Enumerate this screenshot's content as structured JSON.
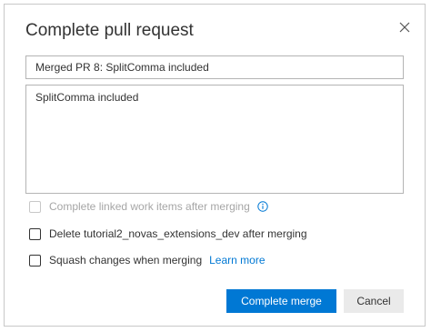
{
  "dialog": {
    "title": "Complete pull request",
    "close_icon": "close-icon"
  },
  "form": {
    "title_value": "Merged PR 8: SplitComma included",
    "description_value": "SplitComma included"
  },
  "options": {
    "complete_work_items": {
      "label": "Complete linked work items after merging",
      "checked": false,
      "disabled": true,
      "info_icon": "info-icon"
    },
    "delete_branch": {
      "label": "Delete tutorial2_novas_extensions_dev after merging",
      "checked": false
    },
    "squash": {
      "label": "Squash changes when merging",
      "checked": false,
      "learn_more": "Learn more"
    }
  },
  "buttons": {
    "complete_merge": "Complete merge",
    "cancel": "Cancel"
  },
  "colors": {
    "accent": "#0078d4",
    "border": "#b4b4b4",
    "disabled_text": "#a6a6a6",
    "secondary_button": "#eaeaea"
  }
}
